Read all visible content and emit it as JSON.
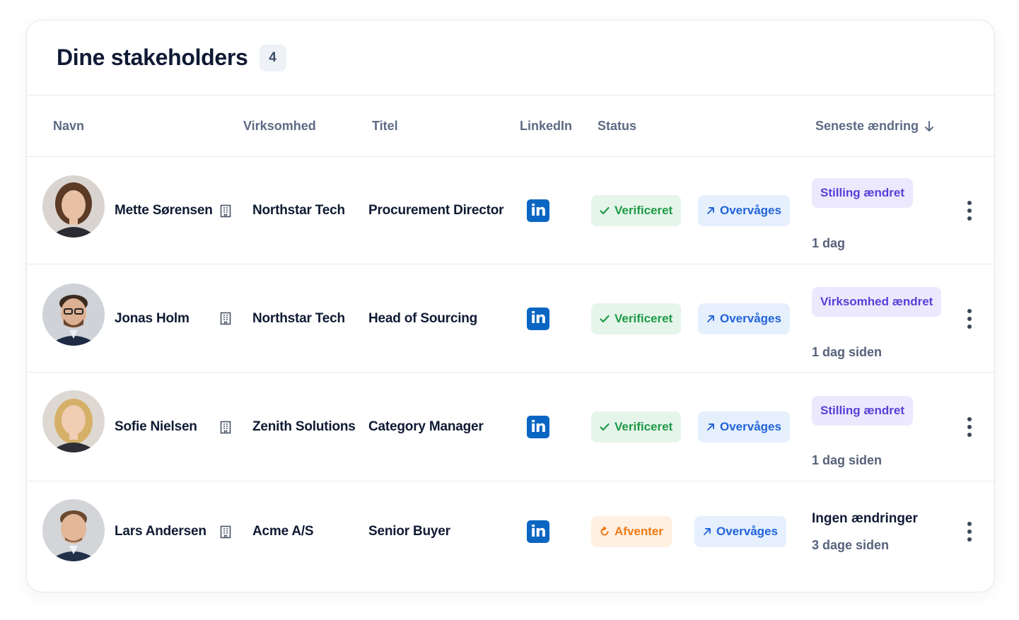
{
  "header": {
    "title": "Dine stakeholders",
    "count": "4"
  },
  "columns": {
    "name": "Navn",
    "company": "Virksomhed",
    "title": "Titel",
    "linkedin": "LinkedIn",
    "status": "Status",
    "last_change": "Seneste ændring"
  },
  "rows": [
    {
      "name": "Mette Sørensen",
      "company": "Northstar Tech",
      "title": "Procurement Director",
      "status": "Verificeret",
      "monitor": "Overvåges",
      "change": "Stilling ændret",
      "time": "1 dag"
    },
    {
      "name": "Jonas Holm",
      "company": "Northstar Tech",
      "title": "Head of Sourcing",
      "status": "Verificeret",
      "monitor": "Overvåges",
      "change": "Virksomhed ændret",
      "time": "1 dag siden"
    },
    {
      "name": "Sofie Nielsen",
      "company": "Zenith Solutions",
      "title": "Category Manager",
      "status": "Verificeret",
      "monitor": "Overvåges",
      "change": "Stilling ændret",
      "time": "1 dag siden"
    },
    {
      "name": "Lars Andersen",
      "company": "Acme A/S",
      "title": "Senior Buyer",
      "status": "Afventer",
      "monitor": "Overvåges",
      "change": "Ingen ændringer",
      "time": "3 dage siden"
    }
  ],
  "linkedin_icon_text": "in",
  "colors": {
    "accent_blue": "#2163d8",
    "linkedin_blue": "#0a66c2",
    "verified_green": "#1f9a46",
    "pending_orange": "#f07a14",
    "change_purple": "#5640d6"
  }
}
